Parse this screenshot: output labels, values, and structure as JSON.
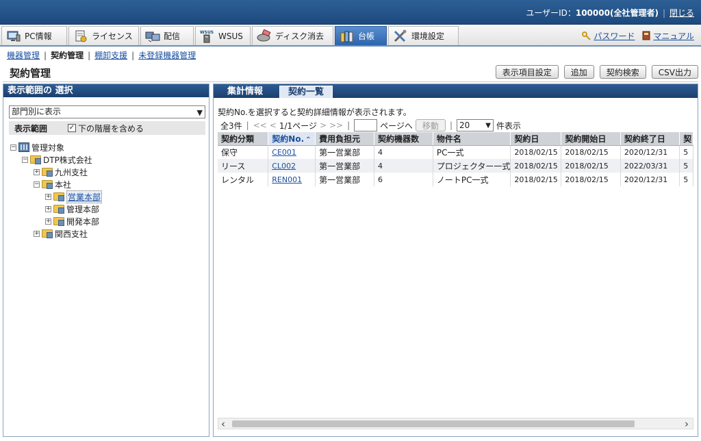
{
  "header": {
    "user_label": "ユーザーID：",
    "user_id": "100000(全社管理者)",
    "close_link": "閉じる"
  },
  "tabs": [
    {
      "label": "PC情報",
      "icon": "pc-info-icon",
      "active": false
    },
    {
      "label": "ライセンス",
      "icon": "license-icon",
      "active": false
    },
    {
      "label": "配信",
      "icon": "distribution-icon",
      "active": false
    },
    {
      "label": "WSUS",
      "icon": "wsus-icon",
      "active": false
    },
    {
      "label": "ディスク消去",
      "icon": "disk-erase-icon",
      "active": false
    },
    {
      "label": "台帳",
      "icon": "ledger-icon",
      "active": true
    },
    {
      "label": "環境設定",
      "icon": "settings-tools-icon",
      "active": false
    }
  ],
  "right_links": {
    "password": "パスワード",
    "manual": "マニュアル"
  },
  "submenu": {
    "items": [
      "機器管理",
      "契約管理",
      "棚卸支援",
      "未登録機器管理"
    ],
    "current": "契約管理"
  },
  "page": {
    "title": "契約管理",
    "buttons": [
      "表示項目設定",
      "追加",
      "契約検索",
      "CSV出力"
    ]
  },
  "left_panel": {
    "title": "表示範囲の 選択",
    "scope_select": "部門別に表示",
    "scope_label": "表示範囲",
    "include_sub_label": "下の階層を含める",
    "include_sub_checked": true,
    "tree": [
      {
        "label": "管理対象",
        "level": 0,
        "expander": "−",
        "icon": "building"
      },
      {
        "label": "DTP株式会社",
        "level": 1,
        "expander": "−",
        "icon": "folder"
      },
      {
        "label": "九州支社",
        "level": 2,
        "expander": "+",
        "icon": "folder"
      },
      {
        "label": "本社",
        "level": 2,
        "expander": "−",
        "icon": "folder"
      },
      {
        "label": "営業本部",
        "level": 3,
        "expander": "+",
        "icon": "folder",
        "selected": true
      },
      {
        "label": "管理本部",
        "level": 3,
        "expander": "+",
        "icon": "folder"
      },
      {
        "label": "開発本部",
        "level": 3,
        "expander": "+",
        "icon": "folder"
      },
      {
        "label": "関西支社",
        "level": 2,
        "expander": "+",
        "icon": "folder"
      }
    ]
  },
  "right_panel": {
    "tabs": [
      {
        "label": "集計情報",
        "active": false
      },
      {
        "label": "契約一覧",
        "active": true
      }
    ],
    "hint": "契約No.を選択すると契約詳細情報が表示されます。",
    "pager": {
      "total": "全3件",
      "first": "<<",
      "prev": "<",
      "page_info": "1/1ページ",
      "next": ">",
      "last": ">>",
      "page_suffix": "ページへ",
      "move_button": "移動",
      "per_page": "20",
      "per_page_suffix": "件表示"
    },
    "table": {
      "columns": [
        "契約分類",
        "契約No.",
        "費用負担元",
        "契約機器数",
        "物件名",
        "契約日",
        "契約開始日",
        "契約終了日",
        "契"
      ],
      "sorted_column": "契約No.",
      "rows": [
        [
          "保守",
          "CE001",
          "第一営業部",
          "4",
          "PC一式",
          "2018/02/15",
          "2018/02/15",
          "2020/12/31",
          "5"
        ],
        [
          "リース",
          "CL002",
          "第一営業部",
          "4",
          "プロジェクター一式",
          "2018/02/15",
          "2018/02/15",
          "2022/03/31",
          "5"
        ],
        [
          "レンタル",
          "REN001",
          "第一営業部",
          "6",
          "ノートPC一式",
          "2018/02/15",
          "2018/02/15",
          "2020/12/31",
          "5"
        ]
      ]
    }
  },
  "colors": {
    "header_blue": "#1d4a7d",
    "active_tab": "#2c65ad",
    "link": "#1a4fa0"
  }
}
